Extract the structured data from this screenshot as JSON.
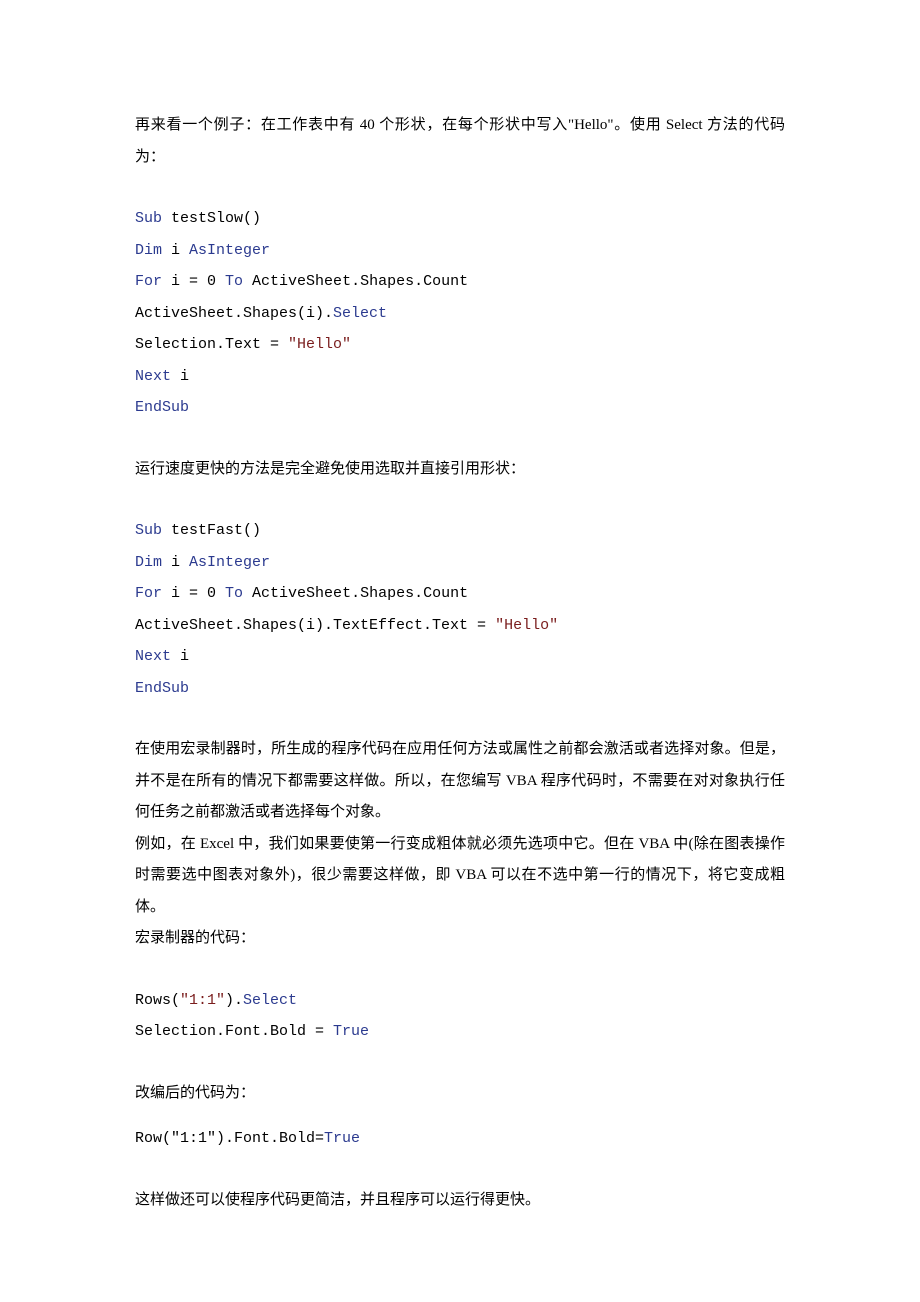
{
  "para1": "再来看一个例子：在工作表中有 40 个形状，在每个形状中写入\"Hello\"。使用 Select 方法的代码为：",
  "code1": {
    "l1a": "Sub",
    "l1b": " testSlow()",
    "l2a": "Dim",
    "l2b": " i ",
    "l2c": "AsInteger",
    "l3a": "For",
    "l3b": " i = 0 ",
    "l3c": "To",
    "l3d": " ActiveSheet.Shapes.Count",
    "l4a": "ActiveSheet.Shapes(i).",
    "l4b": "Select",
    "l5a": "Selection.Text = ",
    "l5b": "\"Hello\"",
    "l6a": "Next",
    "l6b": " i",
    "l7a": "EndSub"
  },
  "para2": "运行速度更快的方法是完全避免使用选取并直接引用形状：",
  "code2": {
    "l1a": "Sub",
    "l1b": " testFast()",
    "l2a": "Dim",
    "l2b": " i ",
    "l2c": "AsInteger",
    "l3a": "For",
    "l3b": " i = 0 ",
    "l3c": "To",
    "l3d": " ActiveSheet.Shapes.Count",
    "l4a": "ActiveSheet.Shapes(i).TextEffect.Text = ",
    "l4b": "\"Hello\"",
    "l5a": "Next",
    "l5b": " i",
    "l6a": "EndSub"
  },
  "para3": "在使用宏录制器时，所生成的程序代码在应用任何方法或属性之前都会激活或者选择对象。但是，并不是在所有的情况下都需要这样做。所以，在您编写 VBA 程序代码时，不需要在对对象执行任何任务之前都激活或者选择每个对象。",
  "para4": "例如，在 Excel 中，我们如果要使第一行变成粗体就必须先选项中它。但在 VBA 中(除在图表操作时需要选中图表对象外)，很少需要这样做，即 VBA 可以在不选中第一行的情况下，将它变成粗体。",
  "para5": "宏录制器的代码：",
  "code3": {
    "l1a": "Rows(",
    "l1b": "\"1:1\"",
    "l1c": ").",
    "l1d": "Select",
    "l2a": "Selection.Font.Bold = ",
    "l2b": "True"
  },
  "para6": "改编后的代码为：",
  "code4": {
    "l1a": "Row(\"1:1\").Font.Bold=",
    "l1b": "True"
  },
  "para7": "这样做还可以使程序代码更简洁，并且程序可以运行得更快。"
}
